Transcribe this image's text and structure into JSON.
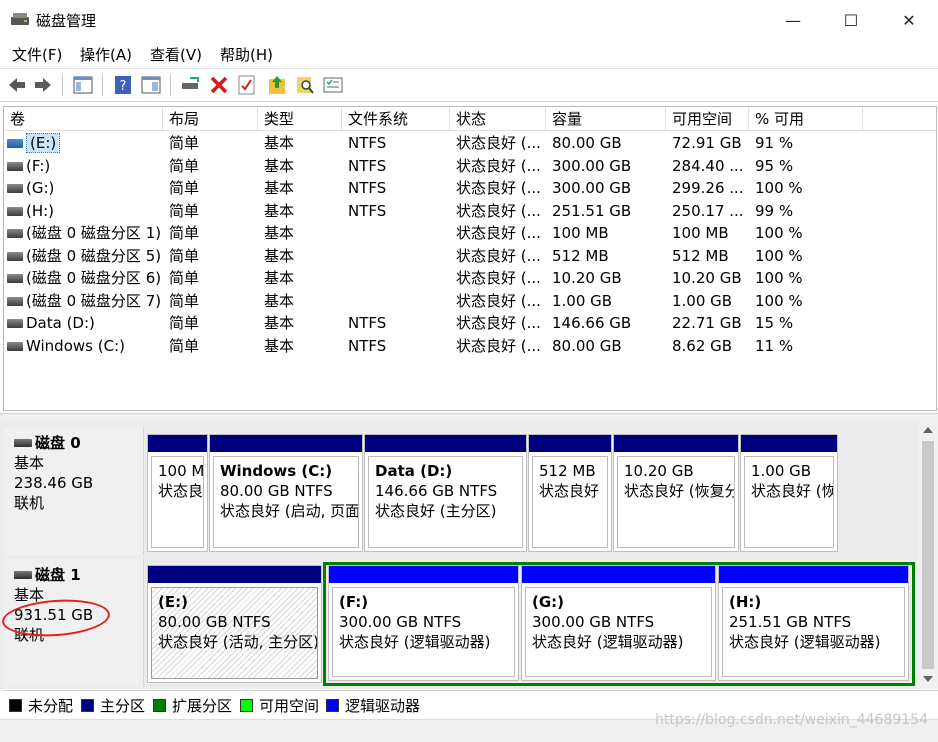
{
  "window": {
    "title": "磁盘管理",
    "minimize": "—",
    "maximize": "☐",
    "close": "✕"
  },
  "menu": [
    "文件(F)",
    "操作(A)",
    "查看(V)",
    "帮助(H)"
  ],
  "toolbar": [
    "back-icon",
    "forward-icon",
    "console-tree-icon",
    "help-icon",
    "properties-icon",
    "connect-icon",
    "delete-icon",
    "check-icon",
    "up-icon",
    "search-icon",
    "list-icon"
  ],
  "columns": [
    "卷",
    "布局",
    "类型",
    "文件系统",
    "状态",
    "容量",
    "可用空间",
    "% 可用"
  ],
  "volumes": [
    {
      "name": "(E:)",
      "layout": "简单",
      "type": "基本",
      "fs": "NTFS",
      "status": "状态良好 (...",
      "cap": "80.00 GB",
      "free": "72.91 GB",
      "pct": "91 %"
    },
    {
      "name": "(F:)",
      "layout": "简单",
      "type": "基本",
      "fs": "NTFS",
      "status": "状态良好 (...",
      "cap": "300.00 GB",
      "free": "284.40 ...",
      "pct": "95 %"
    },
    {
      "name": "(G:)",
      "layout": "简单",
      "type": "基本",
      "fs": "NTFS",
      "status": "状态良好 (...",
      "cap": "300.00 GB",
      "free": "299.26 ...",
      "pct": "100 %"
    },
    {
      "name": "(H:)",
      "layout": "简单",
      "type": "基本",
      "fs": "NTFS",
      "status": "状态良好 (...",
      "cap": "251.51 GB",
      "free": "250.17 ...",
      "pct": "99 %"
    },
    {
      "name": "(磁盘 0 磁盘分区 1)",
      "layout": "简单",
      "type": "基本",
      "fs": "",
      "status": "状态良好 (...",
      "cap": "100 MB",
      "free": "100 MB",
      "pct": "100 %"
    },
    {
      "name": "(磁盘 0 磁盘分区 5)",
      "layout": "简单",
      "type": "基本",
      "fs": "",
      "status": "状态良好 (...",
      "cap": "512 MB",
      "free": "512 MB",
      "pct": "100 %"
    },
    {
      "name": "(磁盘 0 磁盘分区 6)",
      "layout": "简单",
      "type": "基本",
      "fs": "",
      "status": "状态良好 (...",
      "cap": "10.20 GB",
      "free": "10.20 GB",
      "pct": "100 %"
    },
    {
      "name": "(磁盘 0 磁盘分区 7)",
      "layout": "简单",
      "type": "基本",
      "fs": "",
      "status": "状态良好 (...",
      "cap": "1.00 GB",
      "free": "1.00 GB",
      "pct": "100 %"
    },
    {
      "name": "Data (D:)",
      "layout": "简单",
      "type": "基本",
      "fs": "NTFS",
      "status": "状态良好 (...",
      "cap": "146.66 GB",
      "free": "22.71 GB",
      "pct": "15 %"
    },
    {
      "name": "Windows (C:)",
      "layout": "简单",
      "type": "基本",
      "fs": "NTFS",
      "status": "状态良好 (...",
      "cap": "80.00 GB",
      "free": "8.62 GB",
      "pct": "11 %"
    }
  ],
  "disks": [
    {
      "name": "磁盘 0",
      "type": "基本",
      "size": "238.46 GB",
      "state": "联机",
      "partitions": [
        {
          "title": "",
          "line1": "100 M",
          "line2": "状态良",
          "bar": "#00007f"
        },
        {
          "title": "Windows  (C:)",
          "line1": "80.00 GB NTFS",
          "line2": "状态良好 (启动, 页面",
          "bar": "#00007f"
        },
        {
          "title": "Data  (D:)",
          "line1": "146.66 GB NTFS",
          "line2": "状态良好 (主分区)",
          "bar": "#00007f"
        },
        {
          "title": "",
          "line1": "512 MB",
          "line2": "状态良好",
          "bar": "#00007f"
        },
        {
          "title": "",
          "line1": "10.20 GB",
          "line2": "状态良好 (恢复分",
          "bar": "#00007f"
        },
        {
          "title": "",
          "line1": "1.00 GB",
          "line2": "状态良好 (恢",
          "bar": "#00007f"
        }
      ]
    },
    {
      "name": "磁盘 1",
      "type": "基本",
      "size": "931.51 GB",
      "state": "联机",
      "partitions": [
        {
          "title": "(E:)",
          "line1": "80.00 GB NTFS",
          "line2": "状态良好 (活动, 主分区)",
          "bar": "#00007f"
        },
        {
          "title": "(F:)",
          "line1": "300.00 GB NTFS",
          "line2": "状态良好 (逻辑驱动器)",
          "bar": "#0000ff"
        },
        {
          "title": "(G:)",
          "line1": "300.00 GB NTFS",
          "line2": "状态良好 (逻辑驱动器)",
          "bar": "#0000ff"
        },
        {
          "title": "(H:)",
          "line1": "251.51 GB NTFS",
          "line2": "状态良好 (逻辑驱动器)",
          "bar": "#0000ff"
        }
      ]
    }
  ],
  "legend": [
    {
      "label": "未分配",
      "color": "#000000"
    },
    {
      "label": "主分区",
      "color": "#00007f"
    },
    {
      "label": "扩展分区",
      "color": "#008000"
    },
    {
      "label": "可用空间",
      "color": "#00ff00"
    },
    {
      "label": "逻辑驱动器",
      "color": "#0000ff"
    }
  ],
  "watermark": "https://blog.csdn.net/weixin_44689154"
}
